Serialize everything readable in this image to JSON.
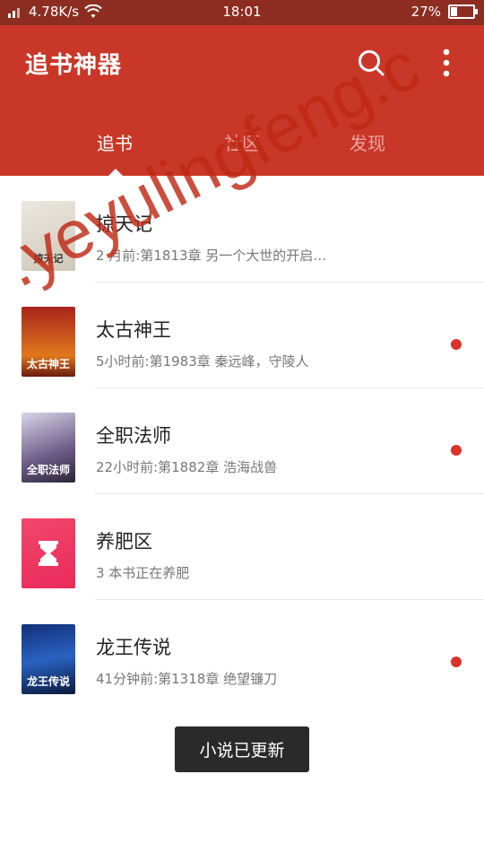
{
  "status_bar": {
    "network": "4.78K/s",
    "time": "18:01",
    "battery": "27%",
    "battery_level": 0.27
  },
  "app": {
    "title": "追书神器"
  },
  "tabs": [
    {
      "label": "追书",
      "active": true
    },
    {
      "label": "社区",
      "active": false
    },
    {
      "label": "发现",
      "active": false
    }
  ],
  "books": [
    {
      "title": "掠天记",
      "subtitle": "2 月前:第1813章 另一个大世的开启…",
      "cover_text": "掠天记",
      "unread": false
    },
    {
      "title": "太古神王",
      "subtitle": "5小时前:第1983章 秦远峰，守陵人",
      "cover_text": "太古神王",
      "unread": true
    },
    {
      "title": "全职法师",
      "subtitle": "22小时前:第1882章 浩海战兽",
      "cover_text": "全职法师",
      "unread": true
    },
    {
      "title": "养肥区",
      "subtitle": "3 本书正在养肥",
      "cover_text": "",
      "unread": false
    },
    {
      "title": "龙王传说",
      "subtitle": "41分钟前:第1318章 绝望镰刀",
      "cover_text": "龙王传说",
      "unread": true
    }
  ],
  "toast": "小说已更新",
  "watermark": ".yeyulingfeng.c",
  "colors": {
    "header": "#c93728",
    "status_bar": "#8d2d22",
    "unread_dot": "#d9332a"
  },
  "icons": {
    "search": "search-icon",
    "more": "more-vert-icon",
    "hourglass": "hourglass-icon"
  }
}
